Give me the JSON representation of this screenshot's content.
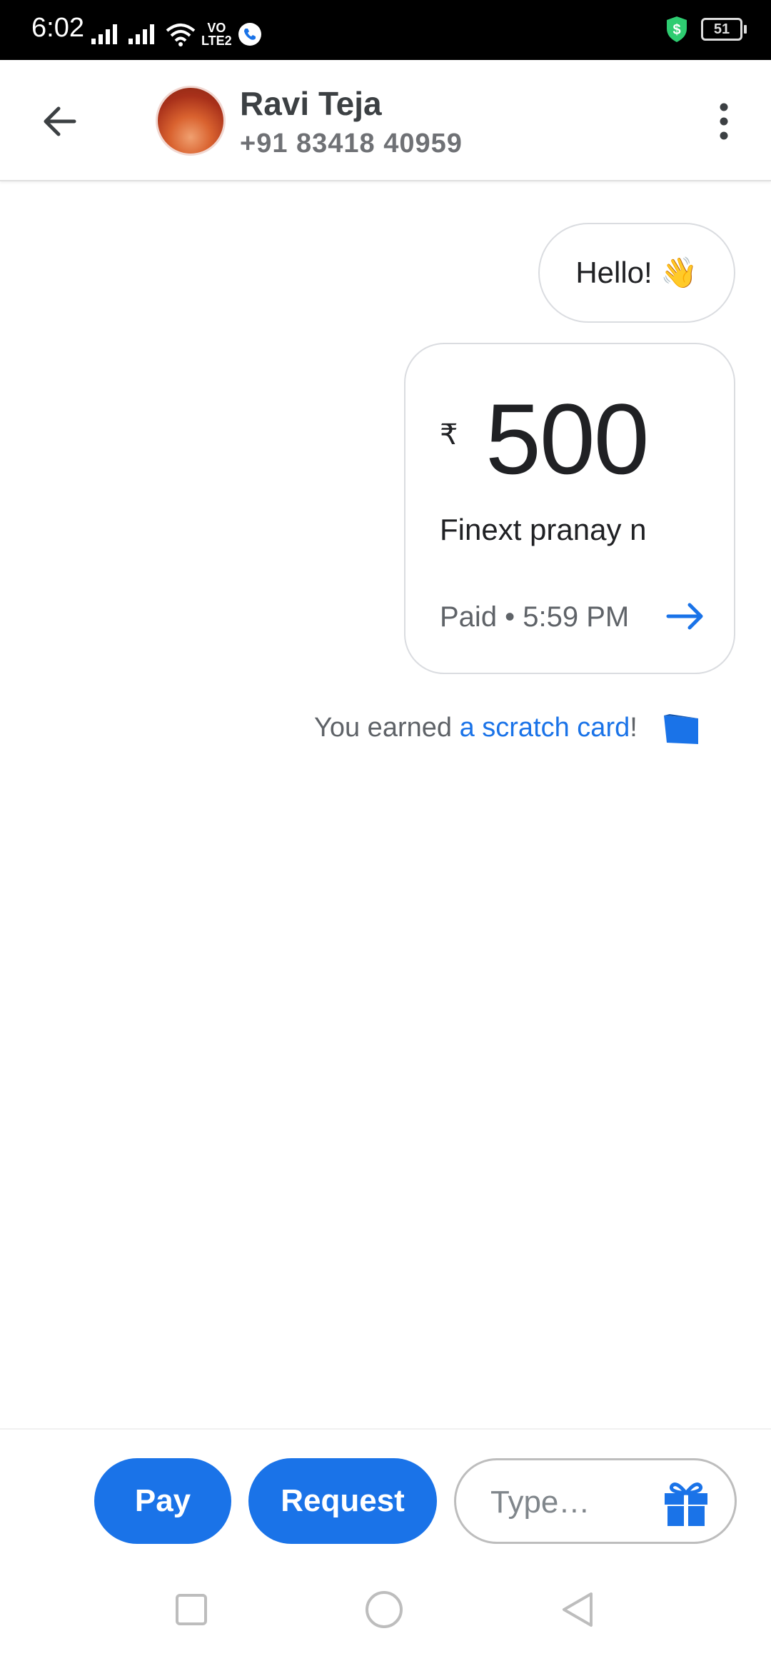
{
  "status_bar": {
    "time": "6:02",
    "volte": "VoLTE2",
    "battery": "51"
  },
  "header": {
    "contact_name": "Ravi Teja",
    "contact_phone": "+91 83418 40959",
    "back_icon": "arrow-left-icon",
    "menu_icon": "more-vert-icon"
  },
  "conversation": {
    "greeting": "Hello! 👋",
    "payment": {
      "currency_symbol": "₹",
      "amount": "500",
      "note": "Finext pranay n",
      "status": "Paid • 5:59 PM"
    },
    "reward": {
      "prefix": "You earned ",
      "link_text": "a scratch card",
      "suffix": "!"
    }
  },
  "bottom_bar": {
    "pay_label": "Pay",
    "request_label": "Request",
    "type_placeholder": "Type…",
    "gift_icon": "gift-icon"
  },
  "colors": {
    "accent": "#1a73e8",
    "text_primary": "#202124",
    "text_secondary": "#5f6368"
  }
}
